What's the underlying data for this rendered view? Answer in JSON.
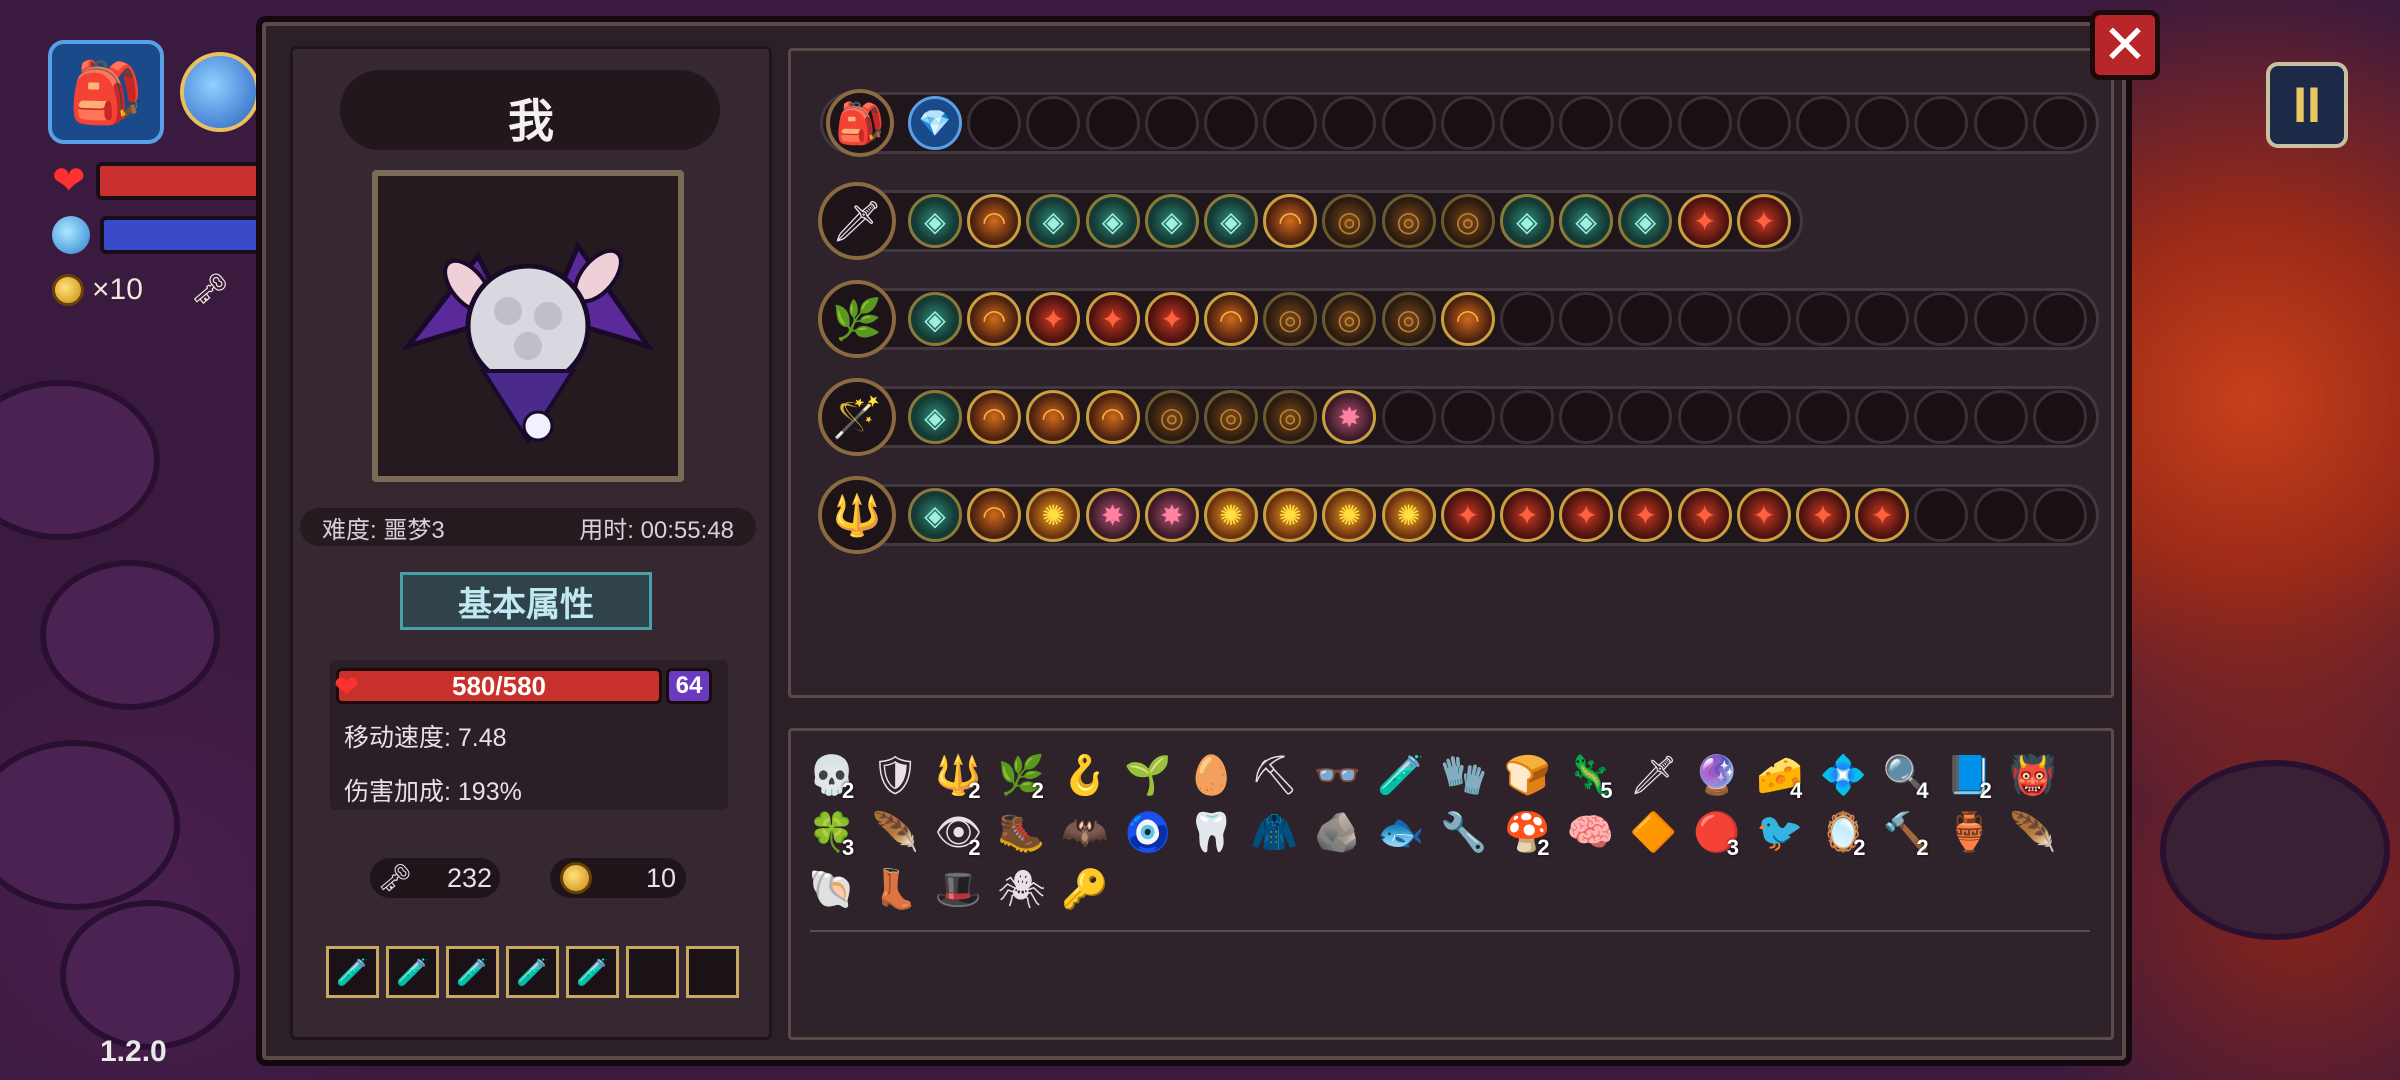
{
  "hud": {
    "gold_label": "×10",
    "version": "1.2.0",
    "pause_label": "II",
    "colors": {
      "hp": "#c83030",
      "mp": "#3a4ac8"
    }
  },
  "panel": {
    "close_label": "✕",
    "player_name": "我",
    "difficulty": "难度: 噩梦3",
    "time_used": "用时: 00:55:48",
    "attributes_title": "基本属性",
    "hp": "580/580",
    "shield": "64",
    "move_speed": "移动速度: 7.48",
    "damage_bonus": "伤害加成: 193%",
    "keys": "232",
    "coins": "10"
  },
  "potions": [
    "🧪",
    "🧪",
    "🧪",
    "🧪",
    "🧪",
    "",
    ""
  ],
  "weapons": [
    {
      "icon": "🎒",
      "gems": [
        "💎"
      ]
    },
    {
      "icon": "🗡",
      "gems": [
        "teal",
        "orange",
        "teal",
        "teal",
        "teal",
        "teal",
        "orange",
        "dim",
        "dim",
        "dim",
        "teal",
        "teal",
        "teal",
        "redg",
        "redg"
      ]
    },
    {
      "icon": "🌿",
      "gems": [
        "teal",
        "orange",
        "redg",
        "redg",
        "redg",
        "orange",
        "dim",
        "dim",
        "dim",
        "orange"
      ]
    },
    {
      "icon": "🪄",
      "gems": [
        "teal",
        "orange",
        "orange",
        "orange",
        "dim",
        "dim",
        "dim",
        "pink"
      ]
    },
    {
      "icon": "🔱",
      "gems": [
        "teal",
        "orange",
        "sun",
        "pink",
        "pink",
        "sun",
        "sun",
        "sun",
        "sun",
        "redg",
        "redg",
        "redg",
        "redg",
        "redg",
        "redg",
        "redg",
        "redg"
      ]
    }
  ],
  "items": [
    {
      "g": "💀",
      "c": "2"
    },
    {
      "g": "🛡",
      "c": ""
    },
    {
      "g": "🔱",
      "c": "2"
    },
    {
      "g": "🌿",
      "c": "2"
    },
    {
      "g": "🪝",
      "c": ""
    },
    {
      "g": "🌱",
      "c": ""
    },
    {
      "g": "🥚",
      "c": ""
    },
    {
      "g": "⛏",
      "c": ""
    },
    {
      "g": "👓",
      "c": ""
    },
    {
      "g": "🧪",
      "c": ""
    },
    {
      "g": "🧤",
      "c": ""
    },
    {
      "g": "🍞",
      "c": ""
    },
    {
      "g": "🦎",
      "c": "5"
    },
    {
      "g": "🗡",
      "c": ""
    },
    {
      "g": "🔮",
      "c": ""
    },
    {
      "g": "🧀",
      "c": "4"
    },
    {
      "g": "💠",
      "c": ""
    },
    {
      "g": "🔍",
      "c": "4"
    },
    {
      "g": "📘",
      "c": "2"
    },
    {
      "g": "👹",
      "c": ""
    },
    {
      "g": "🍀",
      "c": "3"
    },
    {
      "g": "🪶",
      "c": ""
    },
    {
      "g": "👁",
      "c": "2"
    },
    {
      "g": "🥾",
      "c": ""
    },
    {
      "g": "🦇",
      "c": ""
    },
    {
      "g": "🧿",
      "c": ""
    },
    {
      "g": "🦷",
      "c": ""
    },
    {
      "g": "🧥",
      "c": ""
    },
    {
      "g": "🪨",
      "c": ""
    },
    {
      "g": "🐟",
      "c": ""
    },
    {
      "g": "🔧",
      "c": ""
    },
    {
      "g": "🍄",
      "c": "2"
    },
    {
      "g": "🧠",
      "c": ""
    },
    {
      "g": "🔶",
      "c": ""
    },
    {
      "g": "🔴",
      "c": "3"
    },
    {
      "g": "🐦",
      "c": ""
    },
    {
      "g": "🪞",
      "c": "2"
    },
    {
      "g": "🔨",
      "c": "2"
    },
    {
      "g": "🏺",
      "c": ""
    },
    {
      "g": "🪶",
      "c": ""
    },
    {
      "g": "🐚",
      "c": ""
    },
    {
      "g": "👢",
      "c": ""
    },
    {
      "g": "🎩",
      "c": ""
    },
    {
      "g": "🕷",
      "c": ""
    },
    {
      "g": "🔑",
      "c": ""
    }
  ]
}
